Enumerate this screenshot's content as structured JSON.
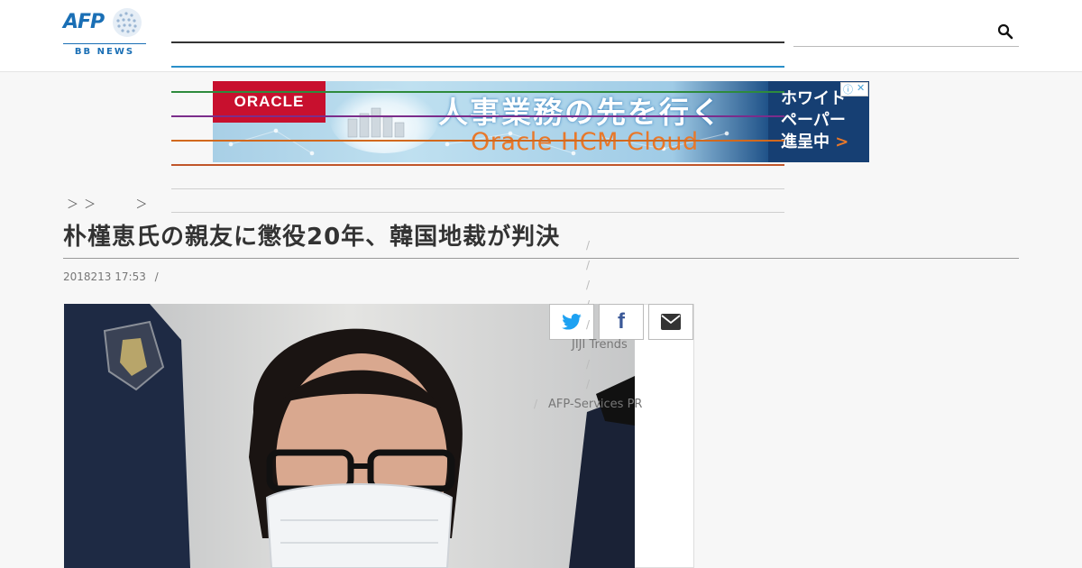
{
  "header": {
    "logo": {
      "brand": "AFP",
      "sub": "BB NEWS"
    },
    "search_icon": "search-icon"
  },
  "ad": {
    "brand": "ORACLE",
    "headline": "人事業務の先を行く",
    "subline": "Oracle HCM Cloud",
    "side_lines": [
      "ホワイト",
      "ペーパー",
      "進呈中"
    ],
    "side_arrow": ">",
    "adchoices_label": "ⓘ",
    "close_label": "✕",
    "colors": {
      "brand_red": "#c8102e",
      "navy": "#163f73",
      "orange": "#e8782a"
    }
  },
  "breadcrumb": [
    "＞",
    "＞",
    "＞"
  ],
  "article": {
    "title": "朴槿恵氏の親友に懲役20年、韓国地裁が判決",
    "date": "2018213 17:53",
    "separator": "/"
  },
  "share": {
    "twitter": "twitter-icon",
    "facebook": "f",
    "mail": "mail-icon"
  },
  "side_links": {
    "jiji": "JIJI Trends",
    "afp_services": "AFP-Services PR",
    "slash": "/"
  },
  "colors": {
    "accent": "#1a6fb5",
    "nav_lines": [
      "#333333",
      "#2a8fc9",
      "#2e8b3d",
      "#7b2d8b",
      "#d2691e",
      "#c0562a"
    ]
  }
}
